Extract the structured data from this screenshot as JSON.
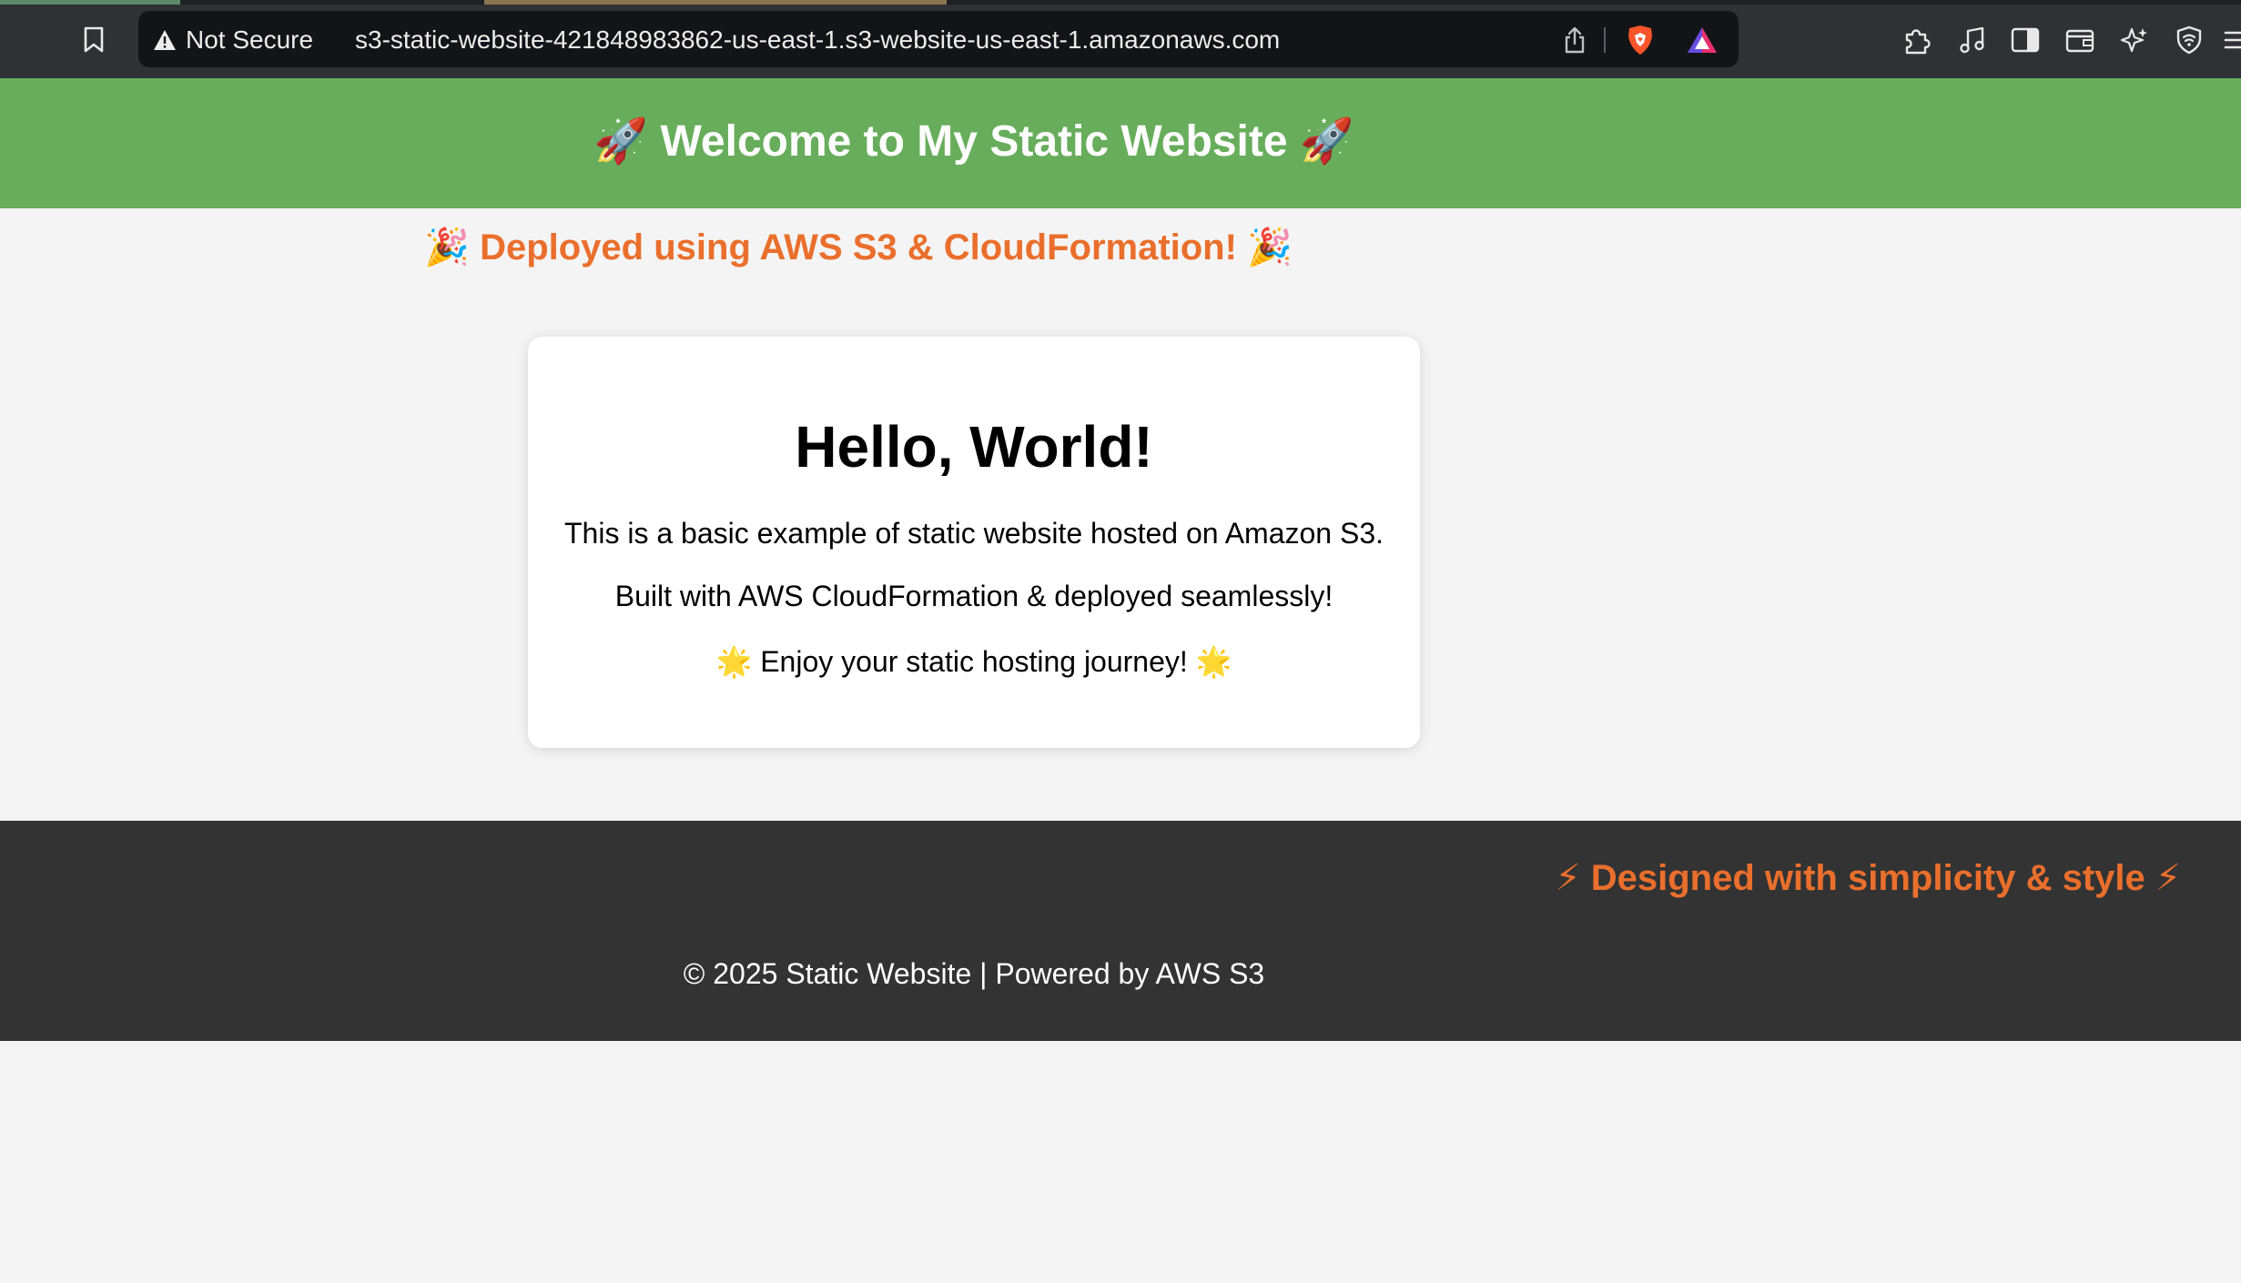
{
  "browser": {
    "security_label": "Not Secure",
    "url": "s3-static-website-421848983862-us-east-1.s3-website-us-east-1.amazonaws.com",
    "icons": [
      "bookmark-icon",
      "warning-icon",
      "share-icon",
      "brave-shields-icon",
      "brave-rewards-icon",
      "extensions-icon",
      "media-icon",
      "sidebar-icon",
      "wallet-icon",
      "leo-ai-icon",
      "vpn-icon",
      "menu-icon"
    ]
  },
  "header": {
    "emoji_left": "🚀",
    "title": "Welcome to My Static Website",
    "emoji_right": "🚀"
  },
  "deploy_note": {
    "emoji_left": "🎉",
    "text": "Deployed using AWS S3 & CloudFormation!",
    "emoji_right": "🎉"
  },
  "card": {
    "title": "Hello, World!",
    "line1": "This is a basic example of static website hosted on Amazon S3.",
    "line2": "Built with AWS CloudFormation & deployed seamlessly!",
    "line3_emoji_left": "🌟",
    "line3": "Enjoy your static hosting journey!",
    "line3_emoji_right": "🌟"
  },
  "footer": {
    "tagline_emoji_left": "⚡",
    "tagline": "Designed with simplicity & style",
    "tagline_emoji_right": "⚡",
    "copyright": "© 2025 Static Website | Powered by AWS S3"
  },
  "colors": {
    "header_bg": "#68ad5c",
    "accent_orange": "#ea6f2c",
    "footer_bg": "#333333",
    "page_bg": "#f4f4f4"
  }
}
